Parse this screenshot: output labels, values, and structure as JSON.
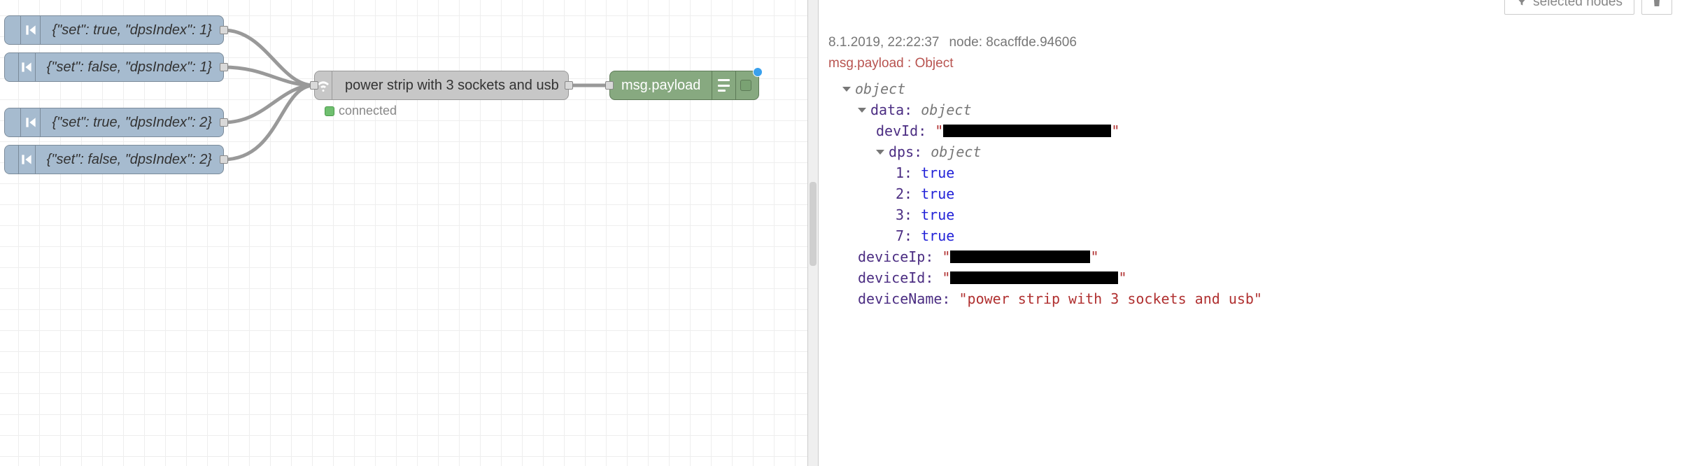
{
  "flow": {
    "inject_nodes": [
      {
        "label": "{\"set\": true, \"dpsIndex\": 1}"
      },
      {
        "label": "{\"set\": false, \"dpsIndex\": 1}"
      },
      {
        "label": "{\"set\": true, \"dpsIndex\": 2}"
      },
      {
        "label": "{\"set\": false, \"dpsIndex\": 2}"
      }
    ],
    "center_node": {
      "label": "power strip with 3 sockets and usb",
      "status": "connected"
    },
    "debug_node": {
      "label": "msg.payload"
    }
  },
  "sidebar": {
    "toolbar": {
      "selected_nodes_label": "selected nodes"
    },
    "meta": {
      "timestamp": "8.1.2019, 22:22:37",
      "node_label": "node: 8cacffde.94606"
    },
    "msg_type_label": "msg.payload : Object",
    "tree": {
      "object_label": "object",
      "data_label": "data:",
      "data_type": "object",
      "devId_key": "devId:",
      "dps_label": "dps:",
      "dps_type": "object",
      "dps": {
        "1": "true",
        "2": "true",
        "3": "true",
        "7": "true"
      },
      "deviceIp_key": "deviceIp:",
      "deviceId_key": "deviceId:",
      "deviceName_key": "deviceName:",
      "deviceName_value": "\"power strip with 3 sockets and usb\"",
      "quote": "\""
    }
  }
}
